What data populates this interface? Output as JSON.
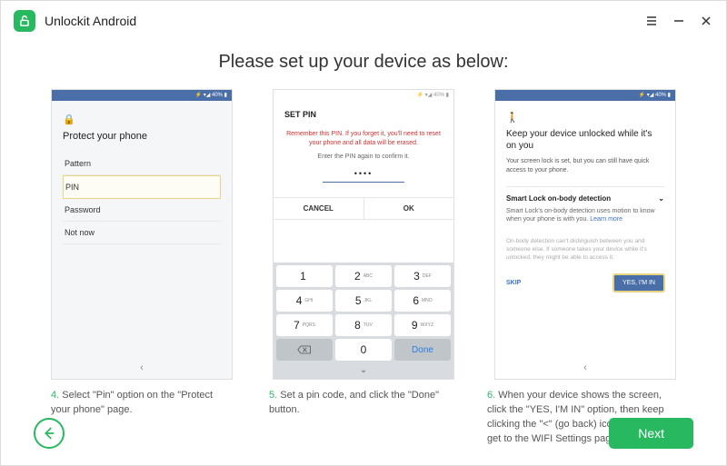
{
  "app": {
    "title": "Unlockit Android"
  },
  "page": {
    "title": "Please set up your device as below:"
  },
  "phone1": {
    "status": "⚡ ▾◢ 40% ▮",
    "title": "Protect your phone",
    "pattern": "Pattern",
    "pin": "PIN",
    "password": "Password",
    "notnow": "Not now",
    "back": "‹"
  },
  "phone2": {
    "status": "⚡ ▾◢ 40% ▮",
    "header": "SET PIN",
    "warn": "Remember this PIN. If you forget it, you'll need to reset your phone and all data will be erased.",
    "sub": "Enter the PIN again to confirm it.",
    "dots": "••••",
    "cancel": "CANCEL",
    "ok": "OK",
    "keys": [
      {
        "n": "1",
        "l": ""
      },
      {
        "n": "2",
        "l": "ABC"
      },
      {
        "n": "3",
        "l": "DEF"
      },
      {
        "n": "4",
        "l": "GHI"
      },
      {
        "n": "5",
        "l": "JKL"
      },
      {
        "n": "6",
        "l": "MNO"
      },
      {
        "n": "7",
        "l": "PQRS"
      },
      {
        "n": "8",
        "l": "TUV"
      },
      {
        "n": "9",
        "l": "WXYZ"
      }
    ],
    "done": "Done",
    "drop": "⌄"
  },
  "phone3": {
    "status": "⚡ ▾◢ 40% ▮",
    "title": "Keep your device unlocked while it's on you",
    "sub": "Your screen lock is set, but you can still have quick access to your phone.",
    "sectionTitle": "Smart Lock on-body detection",
    "sectionText1": "Smart Lock's on-body detection uses motion to know when your phone is with you. ",
    "learn": "Learn more",
    "note": "On-body detection can't distinguish between you and someone else. If someone takes your device while it's unlocked, they might be able to access it.",
    "skip": "SKIP",
    "yes": "YES, I'M IN",
    "back": "‹"
  },
  "captions": {
    "c4n": "4.",
    "c4": " Select \"Pin\" option on the \"Protect your phone\" page.",
    "c5n": "5.",
    "c5": " Set a pin code, and click the \"Done\" button.",
    "c6n": "6.",
    "c6": " When your device shows the screen, click the \"YES, I'M IN\" option, then keep clicking the \"<\" (go back) icon until you get to the WIFI Settings page."
  },
  "footer": {
    "next": "Next"
  }
}
